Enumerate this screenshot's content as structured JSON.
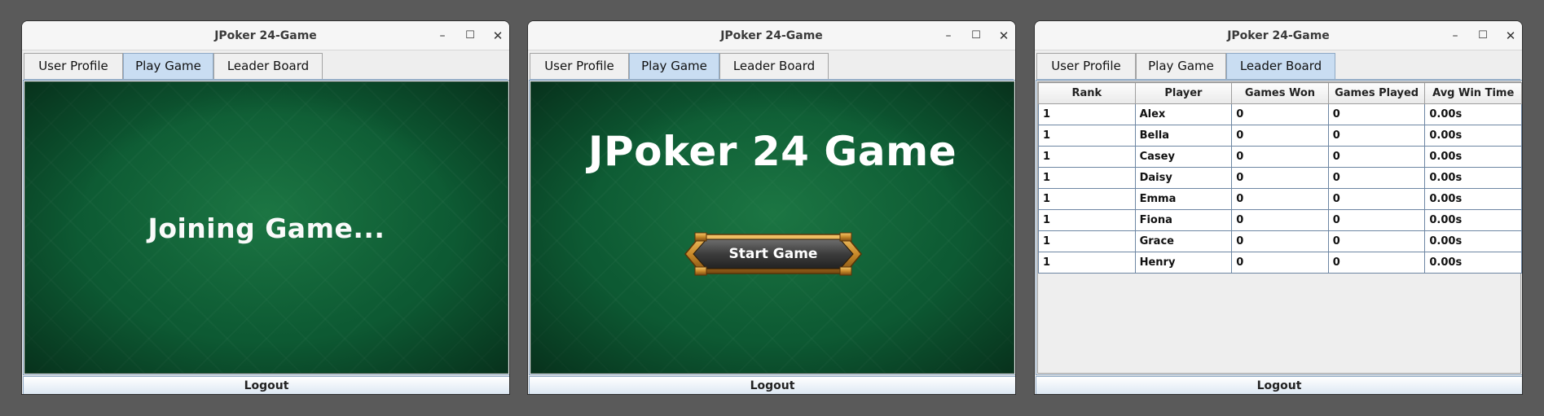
{
  "windows": [
    {
      "title": "JPoker 24-Game",
      "tabs": [
        "User Profile",
        "Play Game",
        "Leader Board"
      ],
      "active_tab": "Play Game",
      "status_text": "Joining Game...",
      "logout_label": "Logout"
    },
    {
      "title": "JPoker 24-Game",
      "tabs": [
        "User Profile",
        "Play Game",
        "Leader Board"
      ],
      "active_tab": "Play Game",
      "game_title": "JPoker 24 Game",
      "start_button_label": "Start Game",
      "logout_label": "Logout"
    },
    {
      "title": "JPoker 24-Game",
      "tabs": [
        "User Profile",
        "Play Game",
        "Leader Board"
      ],
      "active_tab": "Leader Board",
      "table": {
        "columns": [
          "Rank",
          "Player",
          "Games Won",
          "Games Played",
          "Avg Win Time"
        ],
        "rows": [
          [
            "1",
            "Alex",
            "0",
            "0",
            "0.00s"
          ],
          [
            "1",
            "Bella",
            "0",
            "0",
            "0.00s"
          ],
          [
            "1",
            "Casey",
            "0",
            "0",
            "0.00s"
          ],
          [
            "1",
            "Daisy",
            "0",
            "0",
            "0.00s"
          ],
          [
            "1",
            "Emma",
            "0",
            "0",
            "0.00s"
          ],
          [
            "1",
            "Fiona",
            "0",
            "0",
            "0.00s"
          ],
          [
            "1",
            "Grace",
            "0",
            "0",
            "0.00s"
          ],
          [
            "1",
            "Henry",
            "0",
            "0",
            "0.00s"
          ]
        ]
      },
      "logout_label": "Logout"
    }
  ],
  "window_controls": {
    "minimize": "–",
    "maximize": "☐",
    "close": "✕"
  },
  "colors": {
    "felt_green": "#0d5a33",
    "tab_active": "#c9ddf2",
    "button_gold": "#c98a2a",
    "desktop": "#5a5a5a"
  },
  "icons": [
    "minimize-icon",
    "maximize-icon",
    "close-icon"
  ]
}
